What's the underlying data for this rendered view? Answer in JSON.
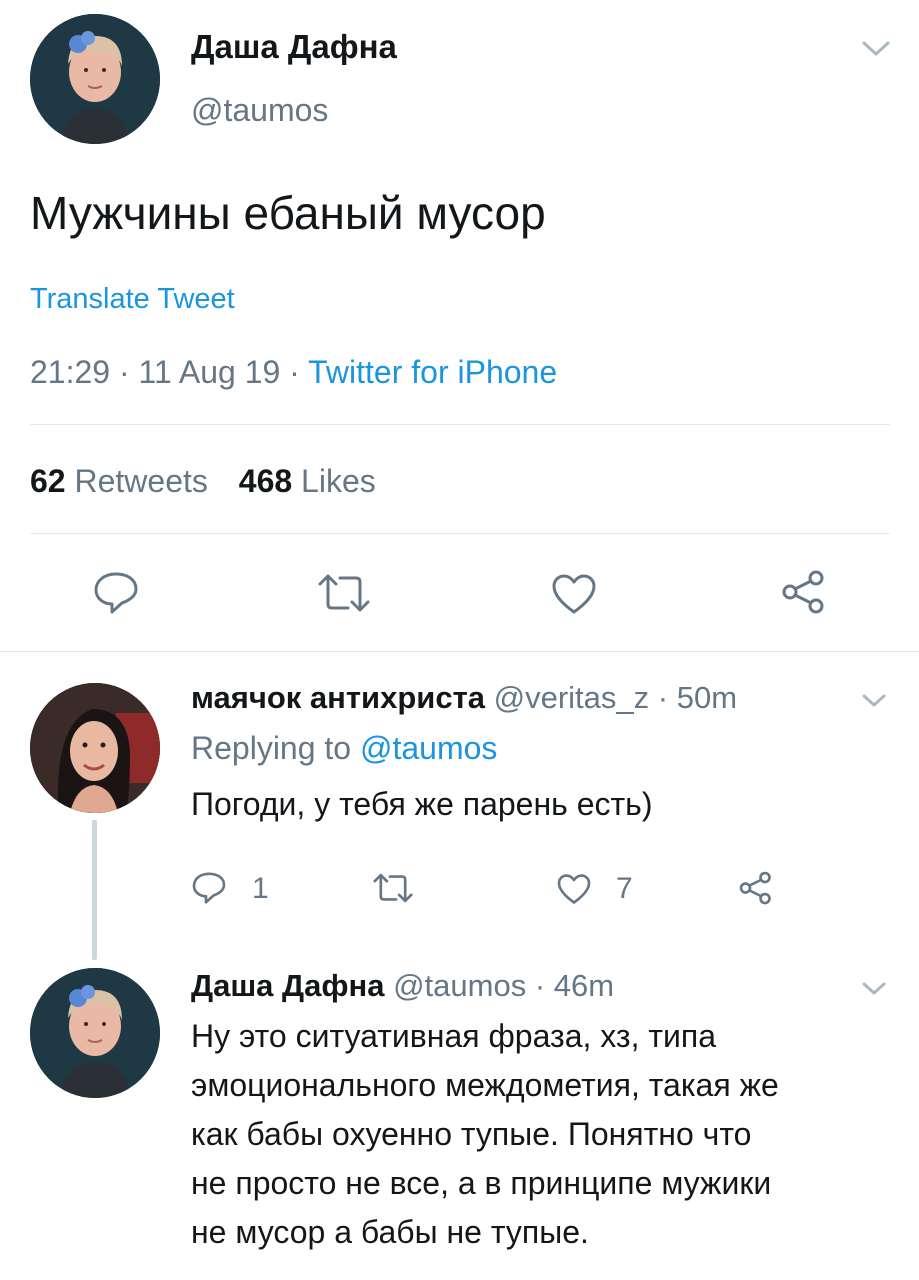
{
  "main_tweet": {
    "author_name": "Даша Дафна",
    "handle": "@taumos",
    "text": "Мужчины ебаный мусор",
    "translate_label": "Translate Tweet",
    "time": "21:29",
    "date": "11 Aug 19",
    "sep": "·",
    "source": "Twitter for iPhone",
    "retweets_count": "62",
    "retweets_label": "Retweets",
    "likes_count": "468",
    "likes_label": "Likes"
  },
  "replies": [
    {
      "author_name": "маячок антихриста",
      "handle": "@veritas_z",
      "time": "· 50m",
      "replying_prefix": "Replying to",
      "replying_handle": "@taumos",
      "text": "Погоди, у тебя же парень есть)",
      "reply_count": "1",
      "retweet_count": "",
      "like_count": "7"
    },
    {
      "author_name": "Даша Дафна",
      "handle": "@taumos",
      "time": "· 46m",
      "text_lines": [
        "Ну это ситуативная фраза, хз, типа",
        "эмоционального междометия, такая же",
        "как бабы охуенно тупые. Понятно что",
        "не просто не все, а в принципе мужики",
        "не мусор а бабы не тупые."
      ]
    }
  ],
  "icons": {
    "reply": "reply-icon",
    "retweet": "retweet-icon",
    "like": "heart-icon",
    "share": "share-icon",
    "more": "chevron-down-icon"
  },
  "colors": {
    "link": "#1b95e0",
    "muted": "#657786",
    "divider": "#e1e8ed",
    "text": "#14171a"
  }
}
